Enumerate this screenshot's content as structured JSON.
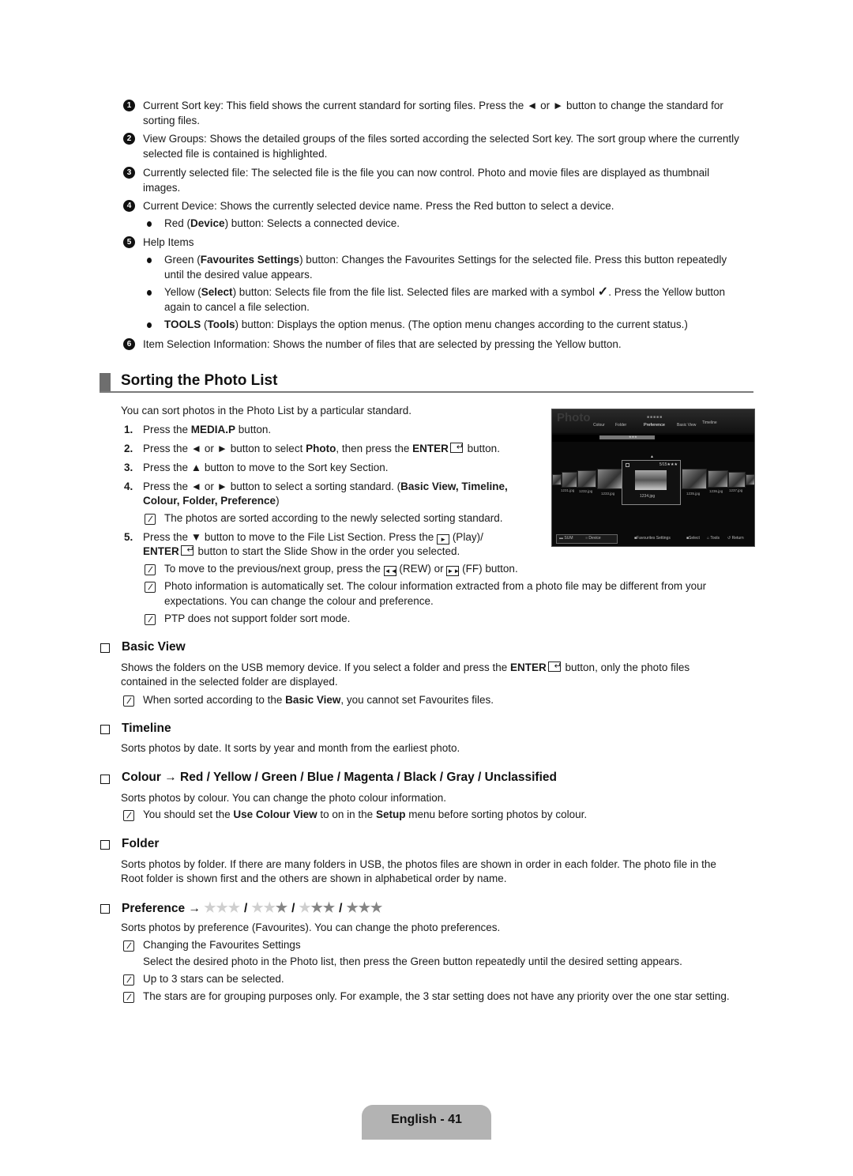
{
  "legend_items": [
    {
      "num": "1",
      "lines": [
        "Current Sort key: This field shows the current standard for sorting files. Press the ◄ or ► button to change the standard for",
        "sorting files."
      ]
    },
    {
      "num": "2",
      "lines": [
        "View Groups: Shows the detailed groups of the files sorted according the selected Sort key. The sort group where the currently",
        "selected file is contained is highlighted."
      ]
    },
    {
      "num": "3",
      "lines": [
        "Currently selected file: The selected file is the file you can now control. Photo and movie files are displayed as thumbnail",
        "images."
      ]
    },
    {
      "num": "4",
      "lines": [
        "Current Device: Shows the currently selected device name. Press the Red button to select a device."
      ]
    },
    {
      "num": "5",
      "lines": [
        "Help Items"
      ]
    },
    {
      "num": "6",
      "lines": [
        "Item Selection Information: Shows the number of files that are selected by pressing the Yellow button."
      ]
    }
  ],
  "device_bullet": {
    "pre": "Red (",
    "bold": "Device",
    "post": ") button: Selects a connected device."
  },
  "help_bullets": [
    {
      "pre": "Green (",
      "bold": "Favourites Settings",
      "post": ") button: Changes the Favourites Settings for the selected file. Press this button repeatedly",
      "line2": "until the desired value appears."
    },
    {
      "pre": "Yellow (",
      "bold": "Select",
      "post": ") button: Selects file from the file list. Selected files are marked with a symbol",
      "post2": ". Press the Yellow button",
      "line2": "again to cancel a file selection.",
      "symbol": "✓"
    },
    {
      "bold_pre": "TOOLS",
      "pre": " (",
      "bold": "Tools",
      "post": ") button: Displays the option menus. (The option menu changes according to the current status.)"
    }
  ],
  "section": {
    "title": "Sorting the Photo List",
    "intro": "You can sort photos in the Photo List by a particular standard.",
    "steps": [
      {
        "n": "1.",
        "pre": "Press the ",
        "bold": "MEDIA.P",
        "post": " button."
      },
      {
        "n": "2.",
        "pre": "Press the ◄ or ► button to select ",
        "bold": "Photo",
        "mid": ", then press the ",
        "bold2": "ENTER",
        "post": " button."
      },
      {
        "n": "3.",
        "text": "Press the ▲ button to move to the Sort key Section."
      },
      {
        "n": "4.",
        "pre": "Press the ◄ or ► button to select a sorting standard. (",
        "bold": "Basic View, Timeline,",
        "line2_bold": "Colour, Folder, Preference",
        "line2_post": ")"
      },
      {
        "n": "5.",
        "pre": "Press the ▼ button to move to the File List Section. Press the",
        "play_icon": "►",
        "post": " (Play)/",
        "line2_bold": "ENTER",
        "line2_post": " button to start the Slide Show in the order you selected."
      }
    ],
    "step4_note": "The photos are sorted according to the newly selected sorting standard.",
    "step5_notes": {
      "rew_ff": {
        "pre": "To move to the previous/next group, press the",
        "rew_icon": "◄◄",
        "mid": " (REW) or ",
        "ff_icon": "►►",
        "post": " (FF) button."
      },
      "photo_info": [
        "Photo information is automatically set. The colour information extracted from a photo file may be different from your",
        "expectations. You can change the colour and preference."
      ],
      "ptp": "PTP does not support folder sort mode."
    }
  },
  "tv_screen": {
    "title": "Photo",
    "sort_keys": [
      "Colour",
      "Folder",
      "Preference",
      "Basic View",
      "Timeline"
    ],
    "group_stars": "★★★",
    "selected": {
      "label": "1234.jpg",
      "info": "5/15★★★"
    },
    "thumbs": [
      "1231.jpg",
      "1232.jpg",
      "1233.jpg",
      "1235.jpg",
      "1236.jpg",
      "1237.jpg"
    ],
    "bottom": {
      "sum": "SUM",
      "device": "Device",
      "favourites": "Favourites Settings",
      "select": "Select",
      "tools": "Tools",
      "return": "Return"
    }
  },
  "subsections": {
    "basic_view": {
      "title": "Basic View",
      "text_pre": "Shows the folders on the USB memory device. If you select a folder and press the ",
      "text_bold": "ENTER",
      "text_post": " button, only the photo files",
      "text_line2": "contained in the selected folder are displayed.",
      "note": {
        "pre": "When sorted according to the ",
        "bold": "Basic View",
        "post": ", you cannot set Favourites files."
      }
    },
    "timeline": {
      "title": "Timeline",
      "text": "Sorts photos by date. It sorts by year and month from the earliest photo."
    },
    "colour": {
      "title": "Colour → Red / Yellow / Green / Blue / Magenta / Black / Gray / Unclassified",
      "text": "Sorts photos by colour. You can change the photo colour information.",
      "note": {
        "pre": "You should set the ",
        "bold": "Use Colour View",
        "mid": " to on in the ",
        "bold2": "Setup",
        "post": " menu before sorting photos by colour."
      }
    },
    "folder": {
      "title": "Folder",
      "lines": [
        "Sorts photos by folder. If there are many folders in USB, the photos files are shown in order in each folder. The photo file in the",
        "Root folder is shown first and the others are shown in alphabetical order by name."
      ]
    },
    "preference": {
      "title": "Preference →",
      "star_levels": [
        0,
        1,
        2,
        3
      ],
      "max_stars": 3,
      "separator": "/",
      "text": "Sorts photos by preference (Favourites). You can change the photo preferences.",
      "notes": [
        {
          "text": "Changing the Favourites Settings",
          "sub": "Select the desired photo in the Photo list, then press the Green button repeatedly until the desired setting appears."
        },
        {
          "text": "Up to 3 stars can be selected."
        },
        {
          "text": "The stars are for grouping purposes only. For example, the 3 star setting does not have any priority over the one star setting."
        }
      ]
    }
  },
  "footer": {
    "page_label": "English - 41"
  }
}
